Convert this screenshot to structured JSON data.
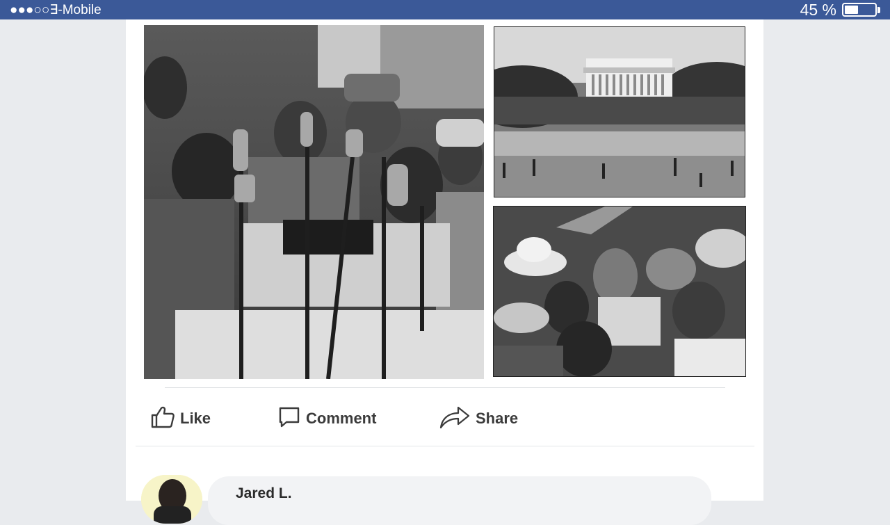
{
  "status_bar": {
    "carrier": "●●●○○∃-Mobile",
    "battery_percent": "45 %",
    "battery_level": 0.45,
    "background_color": "#3b5998"
  },
  "post": {
    "photos": [
      {
        "id": "podium",
        "description_icon": "photo-podium"
      },
      {
        "id": "memorial",
        "description_icon": "photo-lincoln-memorial"
      },
      {
        "id": "crowd",
        "description_icon": "photo-crowd"
      }
    ],
    "actions": {
      "like_label": "Like",
      "comment_label": "Comment",
      "share_label": "Share",
      "like_icon": "thumbs-up-icon",
      "comment_icon": "speech-bubble-icon",
      "share_icon": "share-arrow-icon"
    }
  },
  "comments": [
    {
      "author": "Jared L."
    }
  ]
}
